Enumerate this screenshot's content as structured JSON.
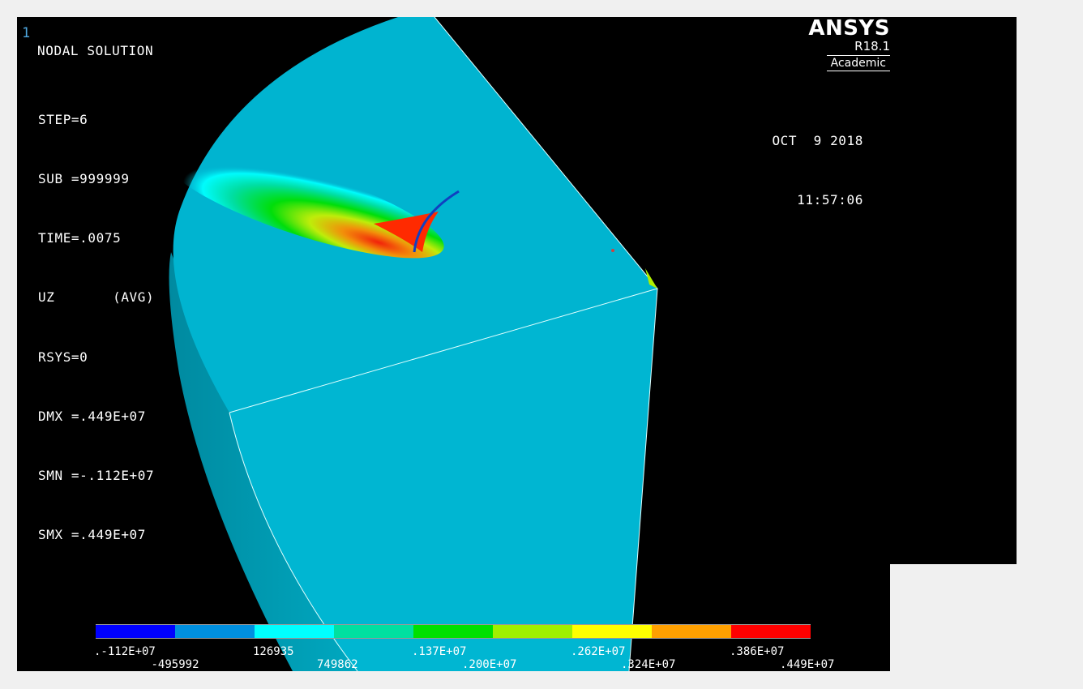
{
  "window_number": "1",
  "plot_title": "NODAL SOLUTION",
  "solution_info": [
    "STEP=6",
    "SUB =999999",
    "TIME=.0075",
    "UZ       (AVG)",
    "RSYS=0",
    "DMX =.449E+07",
    "SMN =-.112E+07",
    "SMX =.449E+07"
  ],
  "logo": {
    "brand": "ANSYS",
    "version": "R18.1",
    "license": "Academic"
  },
  "date": "OCT  9 2018",
  "time": "11:57:06",
  "legend": {
    "colors": [
      "#0000ff",
      "#0090e0",
      "#00ffff",
      "#00e0a0",
      "#00e000",
      "#a0f000",
      "#ffff00",
      "#ffa000",
      "#ff0000"
    ],
    "upper_labels": [
      ".-112E+07",
      "126935",
      ".137E+07",
      ".262E+07",
      ".386E+07"
    ],
    "lower_labels": [
      "-495992",
      "749862",
      ".200E+07",
      ".324E+07",
      ".449E+07"
    ]
  },
  "model_colors": {
    "base": "#00b4d0",
    "background": "#000000"
  }
}
